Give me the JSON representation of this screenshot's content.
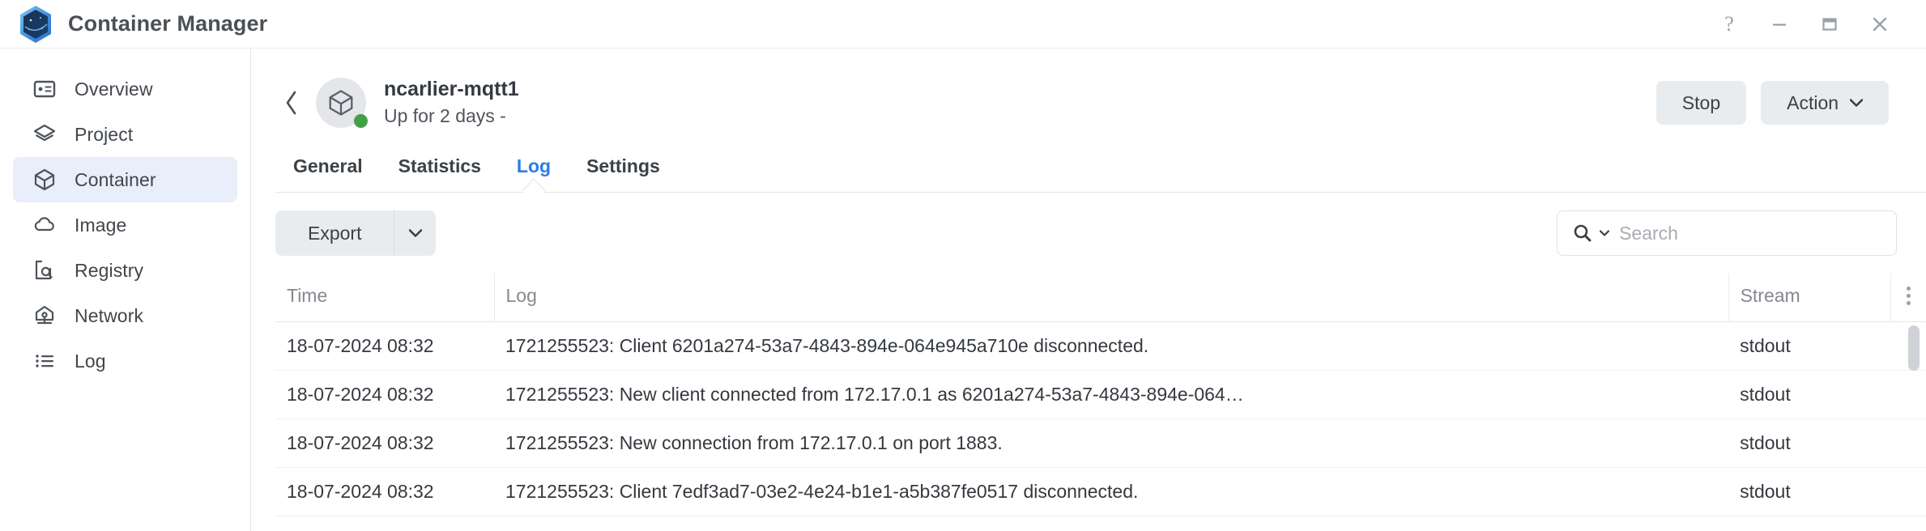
{
  "window": {
    "app_title": "Container Manager",
    "logo_icon": "container-manager-logo",
    "controls": [
      {
        "name": "help-button",
        "icon": "question-mark-icon",
        "label": "?"
      },
      {
        "name": "minimize-button",
        "icon": "minimize-icon",
        "label": "—"
      },
      {
        "name": "maximize-button",
        "icon": "maximize-icon",
        "label": "□"
      },
      {
        "name": "close-button",
        "icon": "close-icon",
        "label": "✕"
      }
    ]
  },
  "sidebar": {
    "items": [
      {
        "label": "Overview",
        "icon": "overview-card-icon",
        "active": false
      },
      {
        "label": "Project",
        "icon": "layers-icon",
        "active": false
      },
      {
        "label": "Container",
        "icon": "cube-icon",
        "active": true
      },
      {
        "label": "Image",
        "icon": "cloud-icon",
        "active": false
      },
      {
        "label": "Registry",
        "icon": "registry-search-icon",
        "active": false
      },
      {
        "label": "Network",
        "icon": "network-icon",
        "active": false
      },
      {
        "label": "Log",
        "icon": "list-icon",
        "active": false
      }
    ]
  },
  "detail": {
    "back_icon": "chevron-left-icon",
    "avatar_icon": "cube-icon",
    "status": "running",
    "status_color": "#43a047",
    "name": "ncarlier-mqtt1",
    "subtitle": "Up for 2 days -",
    "actions": {
      "stop_label": "Stop",
      "action_label": "Action",
      "action_caret_icon": "caret-down-icon"
    }
  },
  "tabs": [
    {
      "label": "General",
      "active": false
    },
    {
      "label": "Statistics",
      "active": false
    },
    {
      "label": "Log",
      "active": true
    },
    {
      "label": "Settings",
      "active": false
    }
  ],
  "toolbar": {
    "export_label": "Export",
    "export_caret_icon": "caret-down-icon",
    "search": {
      "icon": "search-icon",
      "caret_icon": "caret-down-icon",
      "placeholder": "Search",
      "value": ""
    }
  },
  "table": {
    "columns": [
      {
        "key": "time",
        "label": "Time"
      },
      {
        "key": "log",
        "label": "Log"
      },
      {
        "key": "stream",
        "label": "Stream"
      }
    ],
    "options_icon": "kebab-menu-icon",
    "rows": [
      {
        "time": "18-07-2024 08:32",
        "log": "1721255523: Client 6201a274-53a7-4843-894e-064e945a710e disconnected.",
        "stream": "stdout"
      },
      {
        "time": "18-07-2024 08:32",
        "log": "1721255523: New client connected from 172.17.0.1 as 6201a274-53a7-4843-894e-064…",
        "stream": "stdout"
      },
      {
        "time": "18-07-2024 08:32",
        "log": "1721255523: New connection from 172.17.0.1 on port 1883.",
        "stream": "stdout"
      },
      {
        "time": "18-07-2024 08:32",
        "log": "1721255523: Client 7edf3ad7-03e2-4e24-b1e1-a5b387fe0517 disconnected.",
        "stream": "stdout"
      }
    ]
  },
  "colors": {
    "accent": "#2b7de9",
    "sidebar_active_bg": "#e8effa",
    "status_running": "#43a047",
    "button_bg": "#e9ecef",
    "text": "#34393f"
  }
}
